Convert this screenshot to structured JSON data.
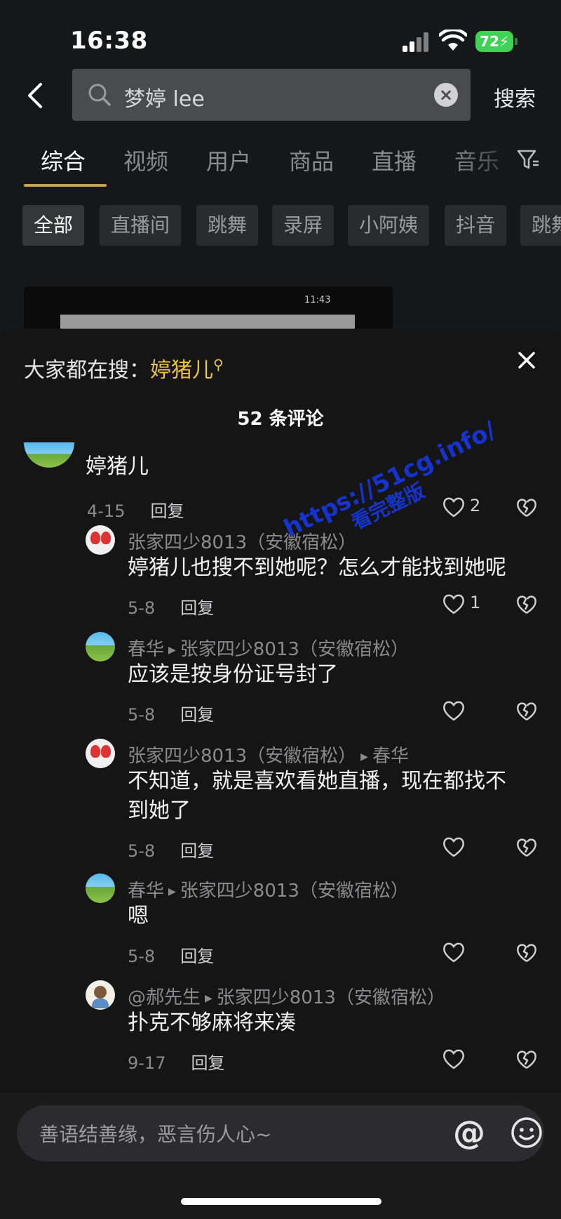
{
  "status_bar": {
    "time": "16:38",
    "battery": "72"
  },
  "search": {
    "query": "梦婷 lee",
    "button": "搜索"
  },
  "tabs": [
    {
      "label": "综合",
      "active": true
    },
    {
      "label": "视频"
    },
    {
      "label": "用户"
    },
    {
      "label": "商品"
    },
    {
      "label": "直播"
    },
    {
      "label": "音乐"
    }
  ],
  "chips": [
    {
      "label": "全部",
      "active": true
    },
    {
      "label": "直播间"
    },
    {
      "label": "跳舞"
    },
    {
      "label": "录屏"
    },
    {
      "label": "小阿姨"
    },
    {
      "label": "抖音"
    },
    {
      "label": "跳舞"
    }
  ],
  "thumb": {
    "mini_time": "11:43"
  },
  "sheet": {
    "hot_prefix": "大家都在搜：",
    "hot_keyword": "婷猪儿",
    "count": "52 条评论"
  },
  "comments": [
    {
      "name": "",
      "text": "婷猪儿",
      "date": "4-15",
      "reply": "回复",
      "likes": "2"
    },
    {
      "name": "张家四少8013（安徽宿松）",
      "text": "婷猪儿也搜不到她呢？怎么才能找到她呢",
      "date": "5-8",
      "reply": "回复",
      "likes": "1"
    },
    {
      "name": "春华",
      "to": "张家四少8013（安徽宿松）",
      "text": "应该是按身份证号封了",
      "date": "5-8",
      "reply": "回复"
    },
    {
      "name": "张家四少8013（安徽宿松）",
      "to": "春华",
      "text": "不知道，就是喜欢看她直播，现在都找不",
      "text2": "到她了",
      "date": "5-8",
      "reply": "回复"
    },
    {
      "name": "春华",
      "to": "张家四少8013（安徽宿松）",
      "text": "嗯",
      "date": "5-8",
      "reply": "回复"
    },
    {
      "name": "@郝先生",
      "to": "张家四少8013（安徽宿松）",
      "text": "扑克不够麻将来凑",
      "date": "9-17",
      "reply": "回复"
    }
  ],
  "watermark": {
    "line1": "https://51cg.info/",
    "line2": "看完整版"
  },
  "input": {
    "placeholder": "善语结善缘，恶言伤人心~",
    "at": "@"
  }
}
